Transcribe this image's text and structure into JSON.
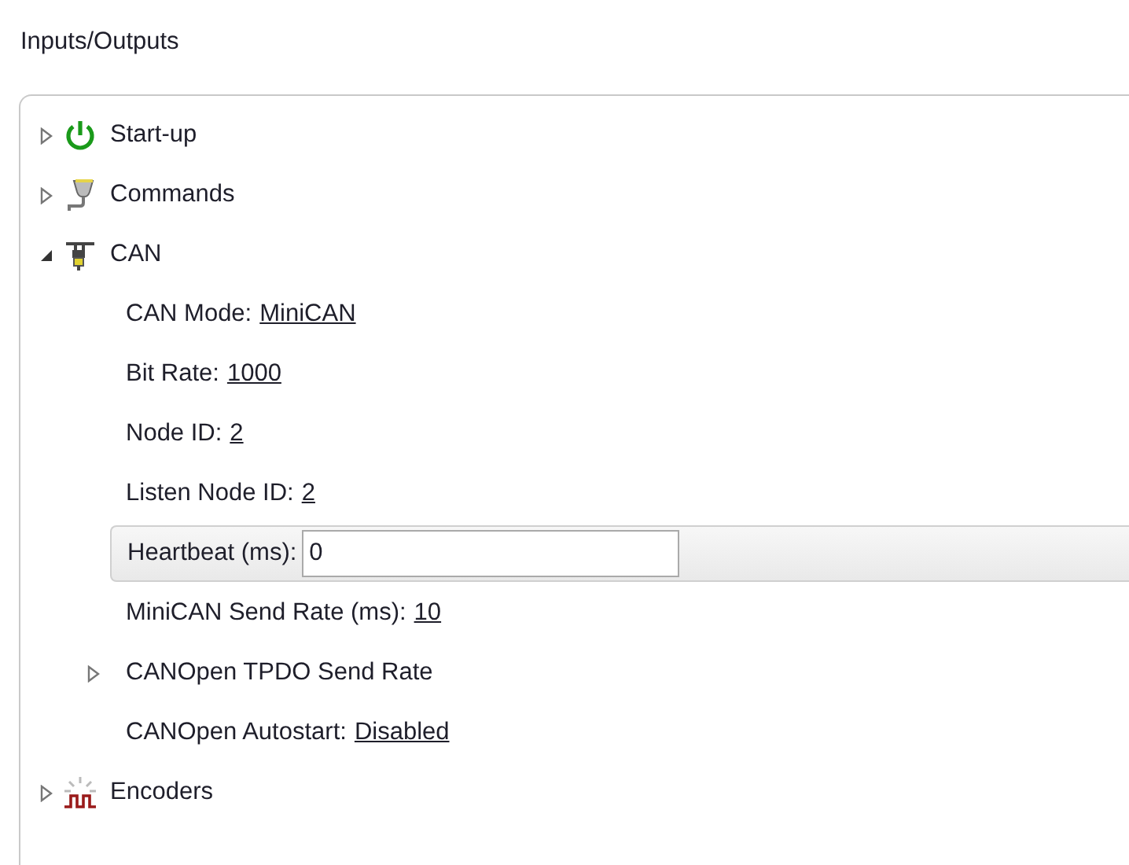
{
  "title": "Inputs/Outputs",
  "tree": [
    {
      "kind": "group",
      "label": "Start-up",
      "expanded": false
    },
    {
      "kind": "group",
      "label": "Commands",
      "expanded": false
    },
    {
      "kind": "group",
      "label": "CAN",
      "expanded": true,
      "children": [
        {
          "kind": "setting",
          "label": "CAN Mode:",
          "value": "MiniCAN"
        },
        {
          "kind": "setting",
          "label": "Bit Rate:",
          "value": "1000"
        },
        {
          "kind": "setting",
          "label": "Node ID:",
          "value": "2"
        },
        {
          "kind": "setting",
          "label": "Listen Node ID:",
          "value": "2"
        },
        {
          "kind": "field",
          "label": "Heartbeat (ms):",
          "value": "0"
        },
        {
          "kind": "setting",
          "label": "MiniCAN Send Rate (ms):",
          "value": "10"
        },
        {
          "kind": "group",
          "label": "CANOpen TPDO Send Rate",
          "expanded": false
        },
        {
          "kind": "setting",
          "label": "CANOpen Autostart:",
          "value": "Disabled"
        }
      ]
    },
    {
      "kind": "group",
      "label": "Encoders",
      "expanded": false
    }
  ]
}
